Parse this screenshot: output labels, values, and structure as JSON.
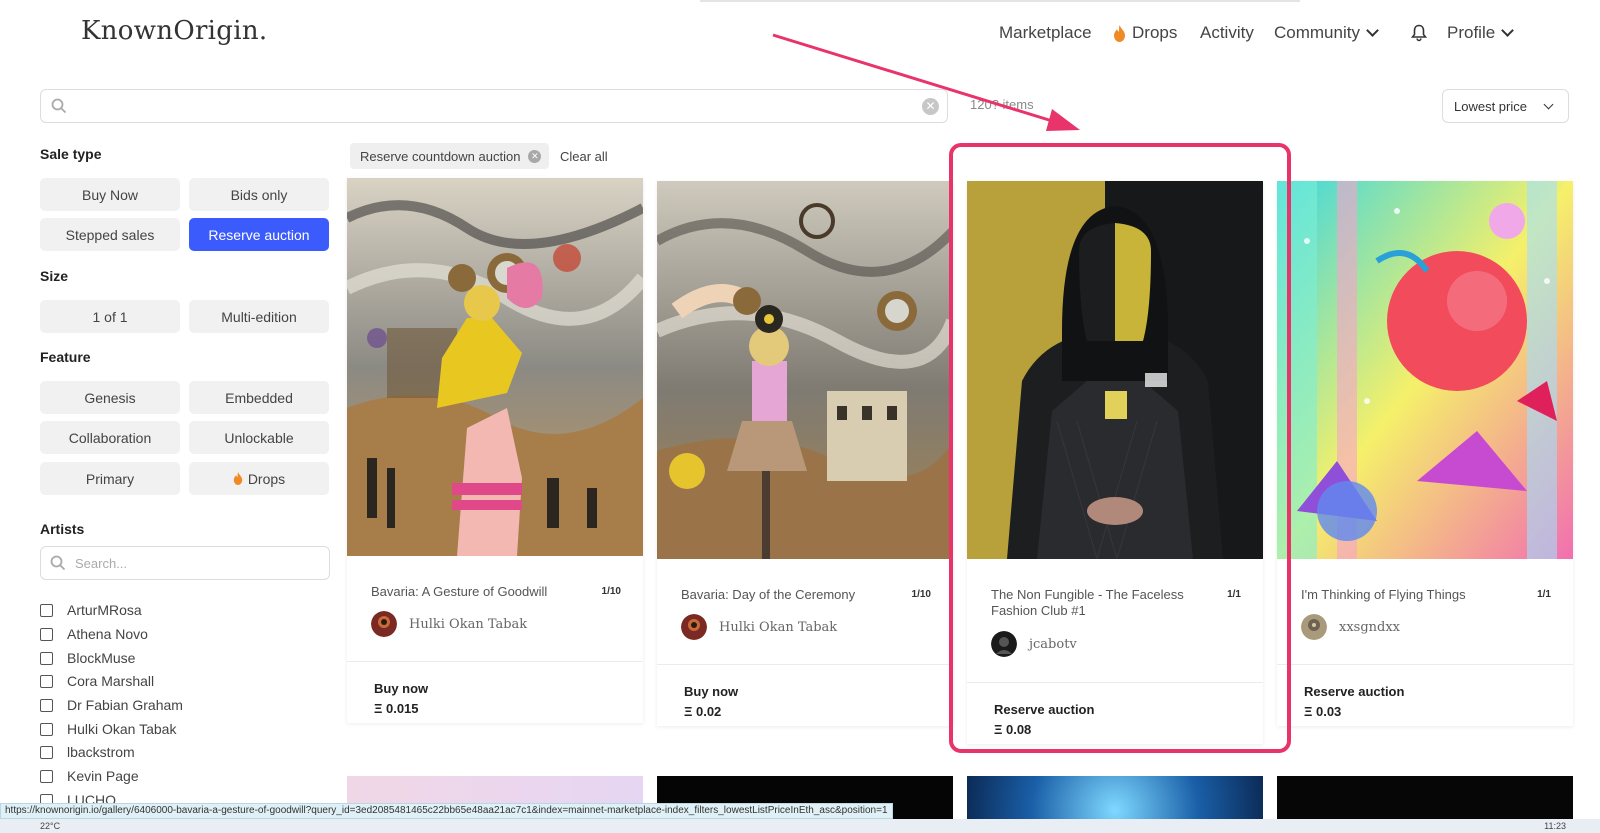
{
  "header": {
    "logo": "KnownOrigin.",
    "nav": {
      "marketplace": "Marketplace",
      "drops": "Drops",
      "activity": "Activity",
      "community": "Community",
      "profile": "Profile"
    }
  },
  "toolbar": {
    "search_value": "",
    "item_count": "120? items",
    "sort_label": "Lowest price"
  },
  "sidebar": {
    "sale_type": {
      "heading": "Sale type",
      "buy_now": "Buy Now",
      "bids_only": "Bids only",
      "stepped_sales": "Stepped sales",
      "reserve_auction": "Reserve auction"
    },
    "size": {
      "heading": "Size",
      "one_of_one": "1 of 1",
      "multi_edition": "Multi-edition"
    },
    "feature": {
      "heading": "Feature",
      "genesis": "Genesis",
      "embedded": "Embedded",
      "collaboration": "Collaboration",
      "unlockable": "Unlockable",
      "primary": "Primary",
      "drops": "Drops"
    },
    "artists": {
      "heading": "Artists",
      "search_placeholder": "Search...",
      "list": [
        "ArturMRosa",
        "Athena Novo",
        "BlockMuse",
        "Cora Marshall",
        "Dr Fabian Graham",
        "Hulki Okan Tabak",
        "lbackstrom",
        "Kevin Page",
        "LUCHO"
      ]
    }
  },
  "filters": {
    "active_chip": "Reserve countdown auction",
    "clear_all": "Clear all"
  },
  "cards": [
    {
      "title": "Bavaria: A Gesture of Goodwill",
      "edition": "1/10",
      "creator": "Hulki Okan Tabak",
      "sale_type": "Buy now",
      "price": "Ξ 0.015"
    },
    {
      "title": "Bavaria: Day of the Ceremony",
      "edition": "1/10",
      "creator": "Hulki Okan Tabak",
      "sale_type": "Buy now",
      "price": "Ξ 0.02"
    },
    {
      "title": "The Non Fungible - The Faceless Fashion Club #1",
      "edition": "1/1",
      "creator": "jcabotv",
      "sale_type": "Reserve auction",
      "price": "Ξ 0.08"
    },
    {
      "title": "I'm Thinking of Flying Things",
      "edition": "1/1",
      "creator": "xxsgndxx",
      "sale_type": "Reserve auction",
      "price": "Ξ 0.03"
    }
  ],
  "status": {
    "url": "https://knownorigin.io/gallery/6406000-bavaria-a-gesture-of-goodwill?query_id=3ed2085481465c22bb65e48aa21ac7c1&index=mainnet-marketplace-index_filters_lowestListPriceInEth_asc&position=1"
  },
  "taskbar": {
    "temp": "22°C",
    "clock": "11:23"
  },
  "colors": {
    "accent": "#3b5bfd",
    "highlight": "#e8336b",
    "drop_flame": "#f08a24"
  }
}
